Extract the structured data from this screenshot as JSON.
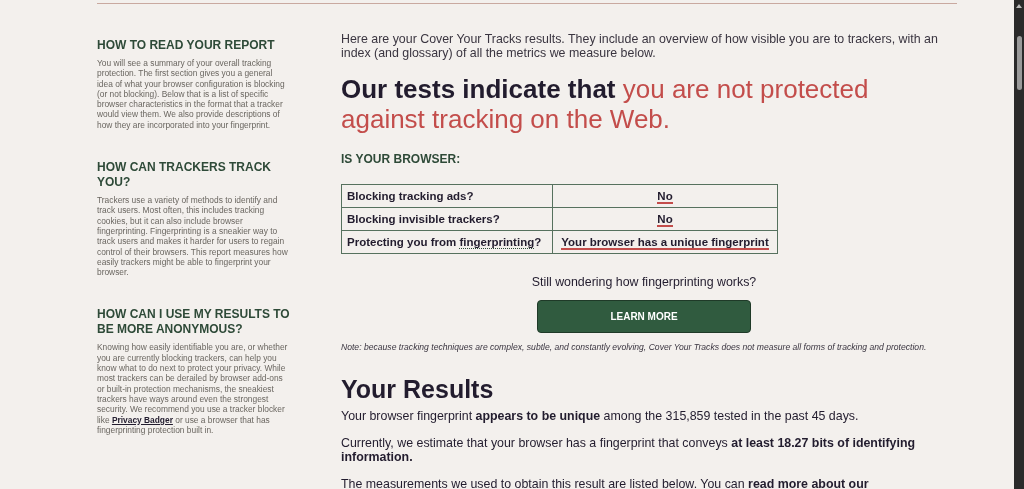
{
  "sidebar": {
    "sections": [
      {
        "heading": "HOW TO READ YOUR REPORT",
        "parts": [
          {
            "kind": "text",
            "text": "You will see a summary of your overall tracking protection. The first section gives you a general idea of what your browser configuration is blocking (or not blocking). Below that is a list of specific browser characteristics in the format that a tracker would view them. We also provide descriptions of how they are incorporated into your fingerprint."
          }
        ]
      },
      {
        "heading": "HOW CAN TRACKERS TRACK YOU?",
        "parts": [
          {
            "kind": "text",
            "text": "Trackers use a variety of methods to identify and track users. Most often, this includes tracking cookies, but it can also include browser fingerprinting. Fingerprinting is a sneakier way to track users and makes it harder for users to regain control of their browsers. This report measures how easily trackers might be able to fingerprint your browser."
          }
        ]
      },
      {
        "heading": "HOW CAN I USE MY RESULTS TO BE MORE ANONYMOUS?",
        "parts": [
          {
            "kind": "text",
            "text": "Knowing how easily identifiable you are, or whether you are currently blocking trackers, can help you know what to do next to protect your privacy. While most trackers can be derailed by browser add-ons or built-in protection mechanisms, the sneakiest trackers have ways around even the strongest security. We recommend you use a tracker blocker like "
          },
          {
            "kind": "link",
            "text": "Privacy Badger"
          },
          {
            "kind": "text",
            "text": " or use a browser that has fingerprinting protection built in."
          }
        ]
      }
    ]
  },
  "main": {
    "intro": "Here are your Cover Your Tracks results. They include an overview of how visible you are to trackers, with an index (and glossary) of all the metrics we measure below.",
    "headline": {
      "lead": "Our tests indicate that",
      "verdict": "you are not protected against tracking on the Web."
    },
    "browser_check": {
      "heading": "IS YOUR BROWSER:",
      "rows": [
        {
          "question": [
            {
              "kind": "text",
              "text": "Blocking tracking ads?"
            }
          ],
          "answer": "No"
        },
        {
          "question": [
            {
              "kind": "text",
              "text": "Blocking invisible trackers?"
            }
          ],
          "answer": "No"
        },
        {
          "question": [
            {
              "kind": "text",
              "text": "Protecting you from "
            },
            {
              "kind": "link",
              "text": "fingerprinting"
            },
            {
              "kind": "text",
              "text": "?"
            }
          ],
          "answer": "Your browser has a unique fingerprint"
        }
      ]
    },
    "prompt": "Still wondering how fingerprinting works?",
    "button": "LEARN MORE",
    "note": "Note: because tracking techniques are complex, subtle, and constantly evolving, Cover Your Tracks does not measure all forms of tracking and protection.",
    "results": {
      "title": "Your Results",
      "paragraphs": [
        [
          {
            "kind": "text",
            "text": "Your browser fingerprint **appears to be unique** among the 315,859 tested in the past 45 days."
          }
        ],
        [
          {
            "kind": "text",
            "text": "Currently, we estimate that your browser has a fingerprint that conveys **at least 18.27 bits of identifying information.**"
          }
        ],
        [
          {
            "kind": "text",
            "text": "The measurements we used to obtain this result are listed below. You can "
          },
          {
            "kind": "link",
            "text": "read more about our"
          }
        ]
      ]
    }
  }
}
